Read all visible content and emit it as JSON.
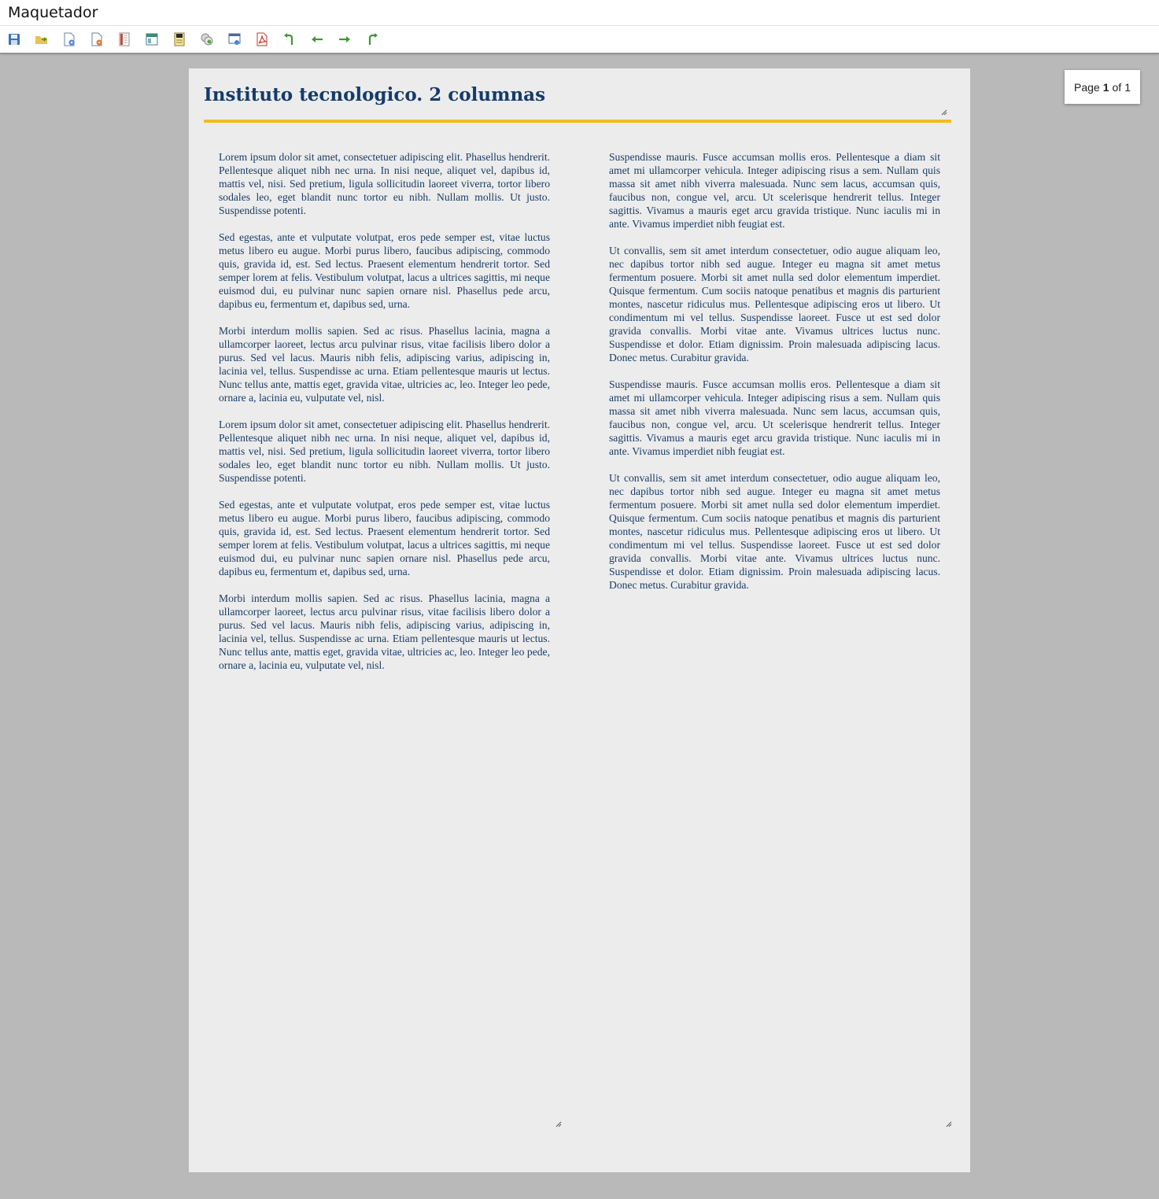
{
  "app": {
    "title": "Maquetador"
  },
  "toolbar": {
    "buttons": [
      {
        "name": "save-icon"
      },
      {
        "name": "open-folder-icon"
      },
      {
        "name": "new-page-icon"
      },
      {
        "name": "delete-page-icon"
      },
      {
        "name": "columns-layout-icon"
      },
      {
        "name": "header-layout-icon"
      },
      {
        "name": "template-icon"
      },
      {
        "name": "images-icon"
      },
      {
        "name": "preview-icon"
      },
      {
        "name": "pdf-icon"
      },
      {
        "name": "undo-icon"
      },
      {
        "name": "arrow-left-icon"
      },
      {
        "name": "arrow-right-icon"
      },
      {
        "name": "redo-icon"
      }
    ]
  },
  "document": {
    "title": "Instituto tecnologico. 2 columnas",
    "left_column": [
      "Lorem ipsum dolor sit amet, consectetuer adipiscing elit. Phasellus hendrerit. Pellentesque aliquet nibh nec urna. In nisi neque, aliquet vel, dapibus id, mattis vel, nisi. Sed pretium, ligula sollicitudin laoreet viverra, tortor libero sodales leo, eget blandit nunc tortor eu nibh. Nullam mollis. Ut justo. Suspendisse potenti.",
      "Sed egestas, ante et vulputate volutpat, eros pede semper est, vitae luctus metus libero eu augue. Morbi purus libero, faucibus adipiscing, commodo quis, gravida id, est. Sed lectus. Praesent elementum hendrerit tortor. Sed semper lorem at felis. Vestibulum volutpat, lacus a ultrices sagittis, mi neque euismod dui, eu pulvinar nunc sapien ornare nisl. Phasellus pede arcu, dapibus eu, fermentum et, dapibus sed, urna.",
      "Morbi interdum mollis sapien. Sed ac risus. Phasellus lacinia, magna a ullamcorper laoreet, lectus arcu pulvinar risus, vitae facilisis libero dolor a purus. Sed vel lacus. Mauris nibh felis, adipiscing varius, adipiscing in, lacinia vel, tellus. Suspendisse ac urna. Etiam pellentesque mauris ut lectus. Nunc tellus ante, mattis eget, gravida vitae, ultricies ac, leo. Integer leo pede, ornare a, lacinia eu, vulputate vel, nisl.",
      "Lorem ipsum dolor sit amet, consectetuer adipiscing elit. Phasellus hendrerit. Pellentesque aliquet nibh nec urna. In nisi neque, aliquet vel, dapibus id, mattis vel, nisi. Sed pretium, ligula sollicitudin laoreet viverra, tortor libero sodales leo, eget blandit nunc tortor eu nibh. Nullam mollis. Ut justo. Suspendisse potenti.",
      "Sed egestas, ante et vulputate volutpat, eros pede semper est, vitae luctus metus libero eu augue. Morbi purus libero, faucibus adipiscing, commodo quis, gravida id, est. Sed lectus. Praesent elementum hendrerit tortor. Sed semper lorem at felis. Vestibulum volutpat, lacus a ultrices sagittis, mi neque euismod dui, eu pulvinar nunc sapien ornare nisl. Phasellus pede arcu, dapibus eu, fermentum et, dapibus sed, urna.",
      "Morbi interdum mollis sapien. Sed ac risus. Phasellus lacinia, magna a ullamcorper laoreet, lectus arcu pulvinar risus, vitae facilisis libero dolor a purus. Sed vel lacus. Mauris nibh felis, adipiscing varius, adipiscing in, lacinia vel, tellus. Suspendisse ac urna. Etiam pellentesque mauris ut lectus. Nunc tellus ante, mattis eget, gravida vitae, ultricies ac, leo. Integer leo pede, ornare a, lacinia eu, vulputate vel, nisl."
    ],
    "right_column": [
      "Suspendisse mauris. Fusce accumsan mollis eros. Pellentesque a diam sit amet mi ullamcorper vehicula. Integer adipiscing risus a sem. Nullam quis massa sit amet nibh viverra malesuada. Nunc sem lacus, accumsan quis, faucibus non, congue vel, arcu. Ut scelerisque hendrerit tellus. Integer sagittis. Vivamus a mauris eget arcu gravida tristique. Nunc iaculis mi in ante. Vivamus imperdiet nibh feugiat est.",
      "Ut convallis, sem sit amet interdum consectetuer, odio augue aliquam leo, nec dapibus tortor nibh sed augue. Integer eu magna sit amet metus fermentum posuere. Morbi sit amet nulla sed dolor elementum imperdiet. Quisque fermentum. Cum sociis natoque penatibus et magnis dis parturient montes, nascetur ridiculus mus. Pellentesque adipiscing eros ut libero. Ut condimentum mi vel tellus. Suspendisse laoreet. Fusce ut est sed dolor gravida convallis. Morbi vitae ante. Vivamus ultrices luctus nunc. Suspendisse et dolor. Etiam dignissim. Proin malesuada adipiscing lacus. Donec metus. Curabitur gravida.",
      "Suspendisse mauris. Fusce accumsan mollis eros. Pellentesque a diam sit amet mi ullamcorper vehicula. Integer adipiscing risus a sem. Nullam quis massa sit amet nibh viverra malesuada. Nunc sem lacus, accumsan quis, faucibus non, congue vel, arcu. Ut scelerisque hendrerit tellus. Integer sagittis. Vivamus a mauris eget arcu gravida tristique. Nunc iaculis mi in ante. Vivamus imperdiet nibh feugiat est.",
      "Ut convallis, sem sit amet interdum consectetuer, odio augue aliquam leo, nec dapibus tortor nibh sed augue. Integer eu magna sit amet metus fermentum posuere. Morbi sit amet nulla sed dolor elementum imperdiet. Quisque fermentum. Cum sociis natoque penatibus et magnis dis parturient montes, nascetur ridiculus mus. Pellentesque adipiscing eros ut libero. Ut condimentum mi vel tellus. Suspendisse laoreet. Fusce ut est sed dolor gravida convallis. Morbi vitae ante. Vivamus ultrices luctus nunc. Suspendisse et dolor. Etiam dignissim. Proin malesuada adipiscing lacus. Donec metus. Curabitur gravida."
    ]
  },
  "pager": {
    "prefix": "Page",
    "current": "1",
    "of_label": "of",
    "total": "1"
  },
  "colors": {
    "title": "#143b6b",
    "body_text": "#1a3c66",
    "rule": "#f0bd1f",
    "page_bg": "#ececec",
    "workspace_bg": "#b9b9b9"
  }
}
